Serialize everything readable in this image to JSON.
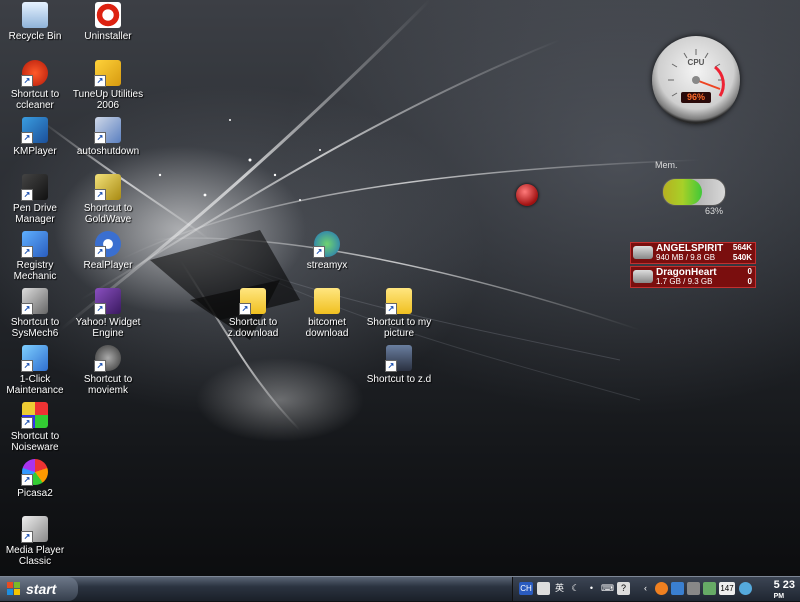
{
  "desktop": {
    "icons": [
      {
        "label": "Recycle Bin"
      },
      {
        "label": "Uninstaller"
      },
      {
        "label": "Shortcut to ccleaner"
      },
      {
        "label": "TuneUp Utilities 2006"
      },
      {
        "label": "KMPlayer"
      },
      {
        "label": "autoshutdown"
      },
      {
        "label": "Pen Drive Manager"
      },
      {
        "label": "Shortcut to GoldWave"
      },
      {
        "label": "Registry Mechanic"
      },
      {
        "label": "RealPlayer"
      },
      {
        "label": "streamyx"
      },
      {
        "label": "Shortcut to SysMech6"
      },
      {
        "label": "Yahoo! Widget Engine"
      },
      {
        "label": "Shortcut to z.download"
      },
      {
        "label": "bitcomet download"
      },
      {
        "label": "Shortcut to my picture"
      },
      {
        "label": "1-Click Maintenance"
      },
      {
        "label": "Shortcut to moviemk"
      },
      {
        "label": "Shortcut to z.d"
      },
      {
        "label": "Shortcut to Noiseware"
      },
      {
        "label": "Picasa2"
      },
      {
        "label": "Media Player Classic"
      }
    ]
  },
  "gadgets": {
    "cpu": {
      "label": "CPU",
      "value": "96%",
      "level": 0.96
    },
    "memory": {
      "label": "Mem.",
      "value": "63%",
      "level": 0.63
    },
    "drives": [
      {
        "name": "ANGELSPIRIT",
        "size": "940 MB / 9.8 GB",
        "rate1": "564K",
        "rate2": "540K"
      },
      {
        "name": "DragonHeart",
        "size": "1.7 GB / 9.3 GB",
        "rate1": "0",
        "rate2": "0"
      }
    ]
  },
  "taskbar": {
    "start_label": "start",
    "tray": {
      "lang": "CH",
      "ime": "英",
      "counter": "147",
      "clock_time": "5 23",
      "clock_ampm": "PM"
    }
  }
}
